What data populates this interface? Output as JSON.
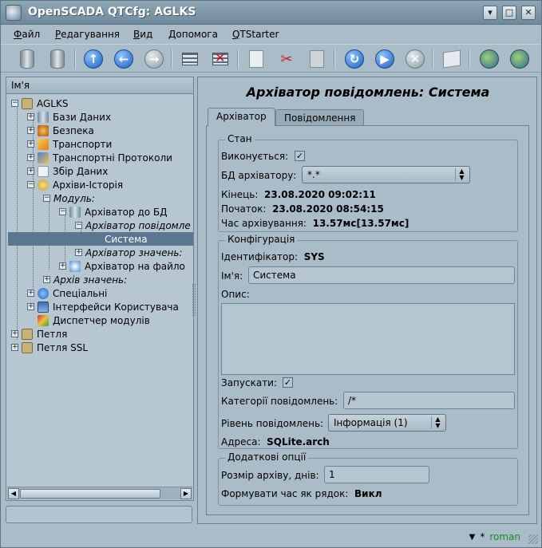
{
  "window": {
    "title": "OpenSCADA QTCfg: AGLKS",
    "buttons": [
      "▾",
      "□",
      "✕"
    ]
  },
  "menu": [
    {
      "label": "Файл",
      "u": "Ф",
      "rest": "айл"
    },
    {
      "label": "Редагування",
      "u": "Р",
      "rest": "едагування"
    },
    {
      "label": "Вид",
      "u": "В",
      "rest": "ид"
    },
    {
      "label": "Допомога",
      "u": "Д",
      "rest": "опомога"
    },
    {
      "label": "QTStarter",
      "u": "Q",
      "rest": "TStarter"
    }
  ],
  "toolbar": {
    "icons": [
      "db-load-icon",
      "db-save-icon",
      "up-icon",
      "back-icon",
      "forward-icon",
      "add-item-icon",
      "delete-item-icon",
      "copy-icon",
      "cut-icon",
      "paste-icon",
      "refresh-icon",
      "start-icon",
      "stop-icon",
      "manual-icon",
      "station-icon-1",
      "station-icon-2"
    ]
  },
  "tree": {
    "header": "Ім'я",
    "items": [
      {
        "label": "AGLKS"
      },
      {
        "label": "Бази Даних"
      },
      {
        "label": "Безпека"
      },
      {
        "label": "Транспорти"
      },
      {
        "label": "Транспортні Протоколи"
      },
      {
        "label": "Збір Даних"
      },
      {
        "label": "Архіви-Історія"
      },
      {
        "label": "Модуль:"
      },
      {
        "label": "Архіватор до БД"
      },
      {
        "label": "Архіватор повідомле"
      },
      {
        "label": "Система"
      },
      {
        "label": "Архіватор значень:"
      },
      {
        "label": "Архіватор на файло"
      },
      {
        "label": "Архів значень:"
      },
      {
        "label": "Спеціальні"
      },
      {
        "label": "Інтерфейси Користувача"
      },
      {
        "label": "Диспетчер модулів"
      },
      {
        "label": "Петля"
      },
      {
        "label": "Петля SSL"
      }
    ]
  },
  "page": {
    "title": "Архіватор повідомлень: Система",
    "tabs": [
      "Архіватор",
      "Повідомлення"
    ]
  },
  "state": {
    "title": "Стан",
    "running_label": "Виконується:",
    "running": true,
    "db_label": "БД архіватору:",
    "db_value": "*.*",
    "end_label": "Кінець:",
    "end_value": "23.08.2020 09:02:11",
    "begin_label": "Початок:",
    "begin_value": "23.08.2020 08:54:15",
    "archtime_label": "Час архівування:",
    "archtime_value": "13.57мс[13.57мс]"
  },
  "config": {
    "title": "Конфігурація",
    "id_label": "Ідентифікатор:",
    "id_value": "SYS",
    "name_label": "Ім'я:",
    "name_value": "Система",
    "descr_label": "Опис:",
    "descr_value": "",
    "start_label": "Запускати:",
    "start": true,
    "categories_label": "Категорії повідомлень:",
    "categories_value": "/*",
    "level_label": "Рівень повідомлень:",
    "level_value": "Інформація (1)",
    "address_label": "Адреса:",
    "address_value": "SQLite.arch"
  },
  "extra": {
    "title": "Додаткові опції",
    "size_label": "Розмір архіву, днів:",
    "size_value": "1",
    "timestr_label": "Формувати час як рядок:",
    "timestr_value": "Викл"
  },
  "status": {
    "marker": "*",
    "user": "roman"
  },
  "colors": {
    "accent": "#5a7690",
    "user": "#1f8a2a"
  }
}
